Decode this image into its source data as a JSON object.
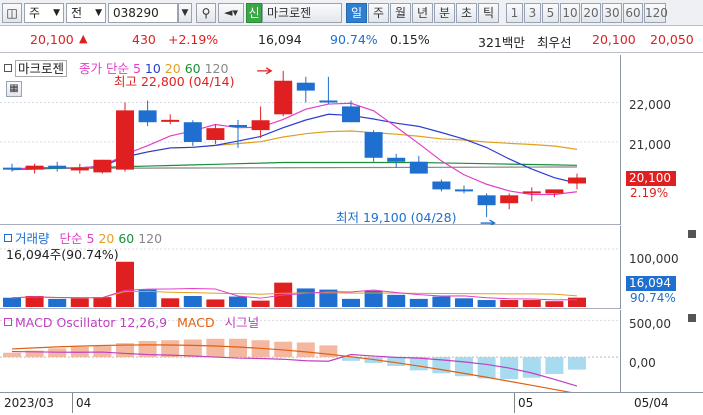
{
  "toolbar": {
    "market": "주",
    "mode": "전",
    "code": "038290",
    "name_button": "마크로젠",
    "name_prefix": "신",
    "periods": [
      "일",
      "주",
      "월",
      "년",
      "분",
      "초",
      "틱"
    ],
    "active_period": "일",
    "ticks": [
      "1",
      "3",
      "5",
      "10",
      "20",
      "30",
      "60",
      "120"
    ]
  },
  "quote": {
    "price": "20,100",
    "change": "430",
    "change_pct": "+2.19%",
    "volume": "16,094",
    "volume_ratio": "90.74%",
    "turnover": "0.15%",
    "amount": "321백만",
    "quote_label": "최우선",
    "ask": "20,100",
    "bid": "20,050"
  },
  "price_panel": {
    "name": "마크로젠",
    "legend": {
      "label": "종가 단순",
      "periods": [
        "5",
        "10",
        "20",
        "60",
        "120"
      ]
    },
    "high_label": "최고 22,800 (04/14)",
    "low_label": "최저 19,100 (04/28)",
    "axis_ticks": [
      "22,000",
      "21,000"
    ],
    "current_price": "20,100",
    "current_pct": "2.19%",
    "colors": {
      "up": "#e02020",
      "down": "#1e6fd0",
      "ma5": "#e040c8",
      "ma10": "#2a3fd0",
      "ma20": "#e0a020",
      "ma60": "#1a8f3a",
      "ma120": "#888888"
    }
  },
  "volume_panel": {
    "title": "거래량",
    "legend_label": "단순",
    "periods": [
      "5",
      "20",
      "60",
      "120"
    ],
    "current": "16,094주(90.74%)",
    "axis_tick": "100,000",
    "current_value": "16,094",
    "current_pct": "90.74%"
  },
  "macd_panel": {
    "title": "MACD Oscillator 12,26,9",
    "macd_label": "MACD",
    "signal_label": "시그널",
    "axis_ticks": [
      "500,00",
      "0,00"
    ]
  },
  "date_axis": {
    "labels": [
      "2023/03",
      "04",
      "05",
      "05/04"
    ]
  },
  "chart_data": {
    "type": "candlestick",
    "candles": [
      {
        "o": 20350,
        "h": 20450,
        "l": 20250,
        "c": 20300
      },
      {
        "o": 20300,
        "h": 20450,
        "l": 20200,
        "c": 20400
      },
      {
        "o": 20400,
        "h": 20500,
        "l": 20250,
        "c": 20330
      },
      {
        "o": 20280,
        "h": 20450,
        "l": 20200,
        "c": 20350
      },
      {
        "o": 20230,
        "h": 20550,
        "l": 20200,
        "c": 20550
      },
      {
        "o": 20300,
        "h": 22000,
        "l": 20250,
        "c": 21800
      },
      {
        "o": 21800,
        "h": 22050,
        "l": 21400,
        "c": 21500
      },
      {
        "o": 21550,
        "h": 21700,
        "l": 21450,
        "c": 21560
      },
      {
        "o": 21500,
        "h": 21550,
        "l": 20900,
        "c": 21000
      },
      {
        "o": 21050,
        "h": 21450,
        "l": 20950,
        "c": 21350
      },
      {
        "o": 21430,
        "h": 21560,
        "l": 20850,
        "c": 21400
      },
      {
        "o": 21300,
        "h": 21900,
        "l": 21100,
        "c": 21550
      },
      {
        "o": 21700,
        "h": 22800,
        "l": 21650,
        "c": 22550
      },
      {
        "o": 22500,
        "h": 22650,
        "l": 22000,
        "c": 22300
      },
      {
        "o": 22050,
        "h": 22650,
        "l": 21950,
        "c": 22000
      },
      {
        "o": 21900,
        "h": 22050,
        "l": 21500,
        "c": 21500
      },
      {
        "o": 21250,
        "h": 21300,
        "l": 20500,
        "c": 20600
      },
      {
        "o": 20600,
        "h": 20700,
        "l": 20350,
        "c": 20500
      },
      {
        "o": 20500,
        "h": 20650,
        "l": 20200,
        "c": 20200
      },
      {
        "o": 20000,
        "h": 20050,
        "l": 19750,
        "c": 19800
      },
      {
        "o": 19800,
        "h": 19900,
        "l": 19700,
        "c": 19750
      },
      {
        "o": 19650,
        "h": 19700,
        "l": 19100,
        "c": 19400
      },
      {
        "o": 19450,
        "h": 19700,
        "l": 19300,
        "c": 19650
      },
      {
        "o": 19700,
        "h": 19850,
        "l": 19500,
        "c": 19750
      },
      {
        "o": 19700,
        "h": 19800,
        "l": 19600,
        "c": 19800
      },
      {
        "o": 19950,
        "h": 20200,
        "l": 19800,
        "c": 20100
      }
    ],
    "volume": [
      16000,
      19000,
      14000,
      15000,
      17000,
      78000,
      30000,
      15000,
      19000,
      13000,
      18000,
      11000,
      42000,
      32000,
      30000,
      14000,
      28000,
      21000,
      14000,
      18000,
      15000,
      12000,
      12000,
      12000,
      10000,
      16094
    ],
    "macd_osc": [
      60,
      90,
      120,
      140,
      150,
      190,
      220,
      230,
      240,
      250,
      250,
      230,
      210,
      200,
      160,
      -50,
      -80,
      -120,
      -180,
      -220,
      -260,
      -290,
      -300,
      -280,
      -230,
      -170
    ],
    "ylim": [
      19000,
      23100
    ],
    "volume_max": 100000,
    "macd_range": [
      -420,
      560
    ]
  }
}
